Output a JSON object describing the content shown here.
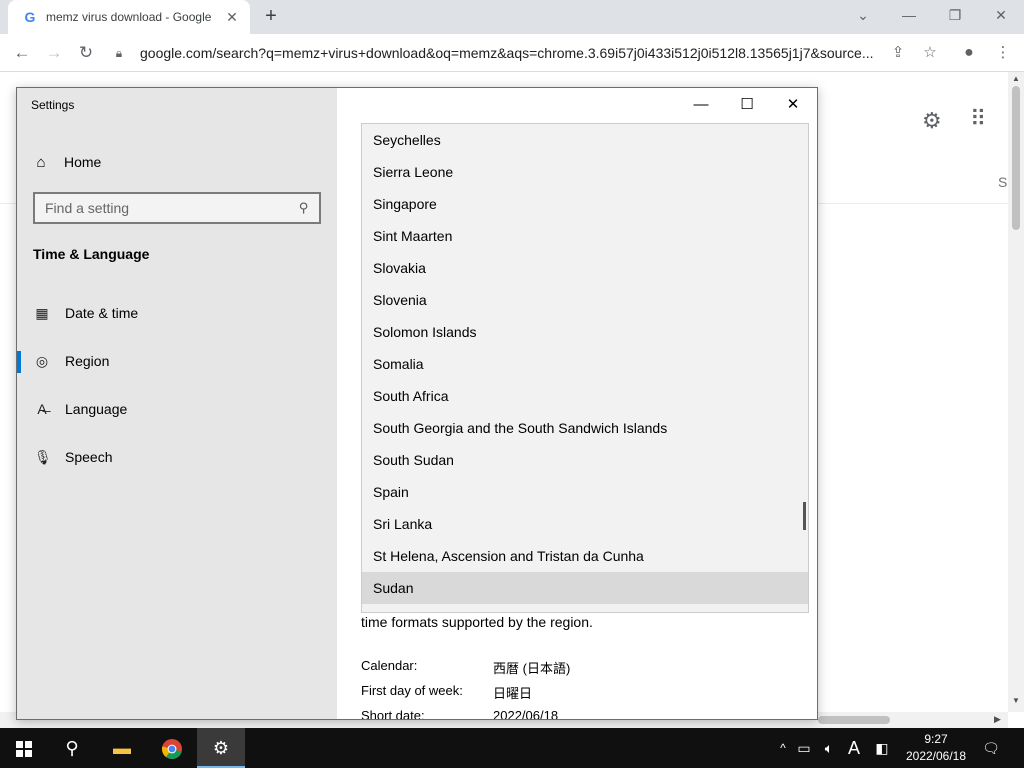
{
  "browser": {
    "tab_title": "memz virus download - Google",
    "tab_favicon": "G",
    "url": "google.com/search?q=memz+virus+download&oq=memz&aqs=chrome.3.69i57j0i433i512j0i512l8.13565j1j7&source...",
    "icons": [
      "back-icon",
      "forward-icon",
      "reload-icon",
      "lock-icon",
      "share-icon",
      "star-icon",
      "profile-icon",
      "menu-icon"
    ]
  },
  "google_page": {
    "partial_text": "S",
    "icons": [
      "gear-icon",
      "apps-icon"
    ]
  },
  "settings": {
    "title": "Settings",
    "home_label": "Home",
    "search_placeholder": "Find a setting",
    "section_title": "Time & Language",
    "nav": [
      {
        "label": "Date & time",
        "icon": "date-time-icon"
      },
      {
        "label": "Region",
        "icon": "region-icon",
        "active": true
      },
      {
        "label": "Language",
        "icon": "language-icon"
      },
      {
        "label": "Speech",
        "icon": "microphone-icon"
      }
    ],
    "country_list": [
      "Seychelles",
      "Sierra Leone",
      "Singapore",
      "Sint Maarten",
      "Slovakia",
      "Slovenia",
      "Solomon Islands",
      "Somalia",
      "South Africa",
      "South Georgia and the South Sandwich Islands",
      "South Sudan",
      "Spain",
      "Sri Lanka",
      "St Helena, Ascension and Tristan da Cunha",
      "Sudan"
    ],
    "selected_country": "Sudan",
    "format_description": "time formats supported by the region.",
    "formats": [
      {
        "label": "Calendar:",
        "value": "西暦 (日本語)"
      },
      {
        "label": "First day of week:",
        "value": "日曜日"
      },
      {
        "label": "Short date:",
        "value": "2022/06/18"
      }
    ]
  },
  "taskbar": {
    "ime_indicator": "A",
    "time": "9:27",
    "date": "2022/06/18"
  }
}
